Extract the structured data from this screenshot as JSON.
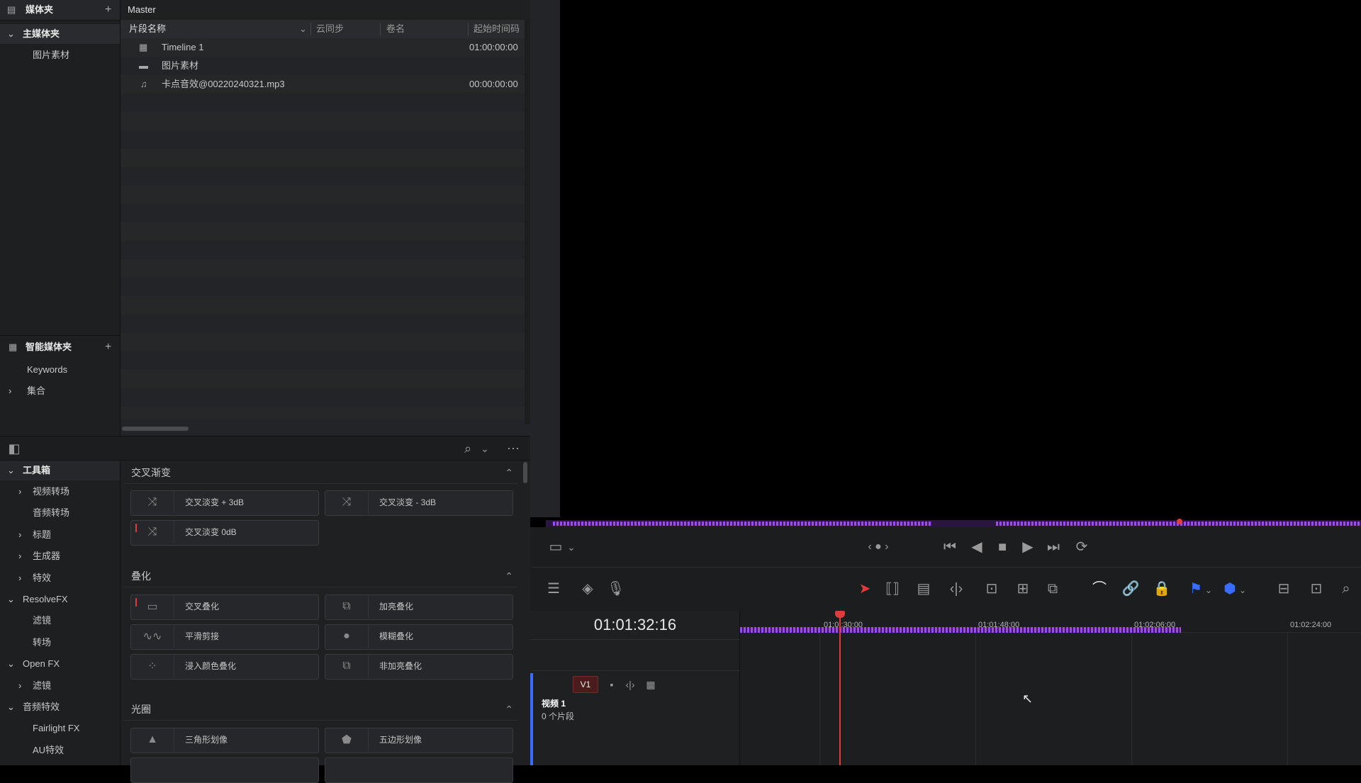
{
  "media_bin": {
    "title": "媒体夹",
    "add": "+",
    "master": "主媒体夹",
    "child": "图片素材",
    "smart_title": "智能媒体夹",
    "smart_add": "+",
    "keywords": "Keywords",
    "collection": "集合"
  },
  "media_pool": {
    "path": "Master",
    "columns": [
      "片段名称",
      "云同步",
      "卷名",
      "起始时间码"
    ],
    "rows": [
      {
        "name": "Timeline 1",
        "timecode": "01:00:00:00",
        "icon": "timeline-icon"
      },
      {
        "name": "图片素材",
        "timecode": "",
        "icon": "folder-icon"
      },
      {
        "name": "卡点音效@00220240321.mp3",
        "timecode": "00:00:00:00",
        "icon": "music-note-icon"
      }
    ]
  },
  "toolbox_tree": {
    "root": "工具箱",
    "items": [
      "视频转场",
      "音频转场",
      "标题",
      "生成器",
      "特效"
    ],
    "resolvefx": "ResolveFX",
    "resolvefx_items": [
      "滤镜",
      "转场"
    ],
    "openfx": "Open FX",
    "openfx_items": [
      "滤镜"
    ],
    "audiofx": "音频特效",
    "audiofx_items": [
      "Fairlight FX",
      "AU特效"
    ]
  },
  "effects": {
    "sections": [
      {
        "title": "交叉渐变",
        "items": [
          "交叉淡变 + 3dB",
          "交叉淡变 - 3dB",
          "交叉淡变 0dB"
        ]
      },
      {
        "title": "叠化",
        "items": [
          "交叉叠化",
          "加亮叠化",
          "平滑剪接",
          "模糊叠化",
          "浸入颜色叠化",
          "非加亮叠化"
        ]
      },
      {
        "title": "光圈",
        "items": [
          "三角形划像",
          "五边形划像"
        ]
      }
    ]
  },
  "timeline": {
    "timecode": "01:01:32:16",
    "ruler": [
      "01:0 :30:00",
      "01:01:48:00",
      "01:02:06:00",
      "01:02:24:00"
    ],
    "track_label": "V1",
    "track_name": "视频 1",
    "track_count": "0 个片段"
  },
  "colors": {
    "accent_purple": "#7a2fd0",
    "playhead": "#e03a3a",
    "panel_bg": "#1e1f21"
  }
}
